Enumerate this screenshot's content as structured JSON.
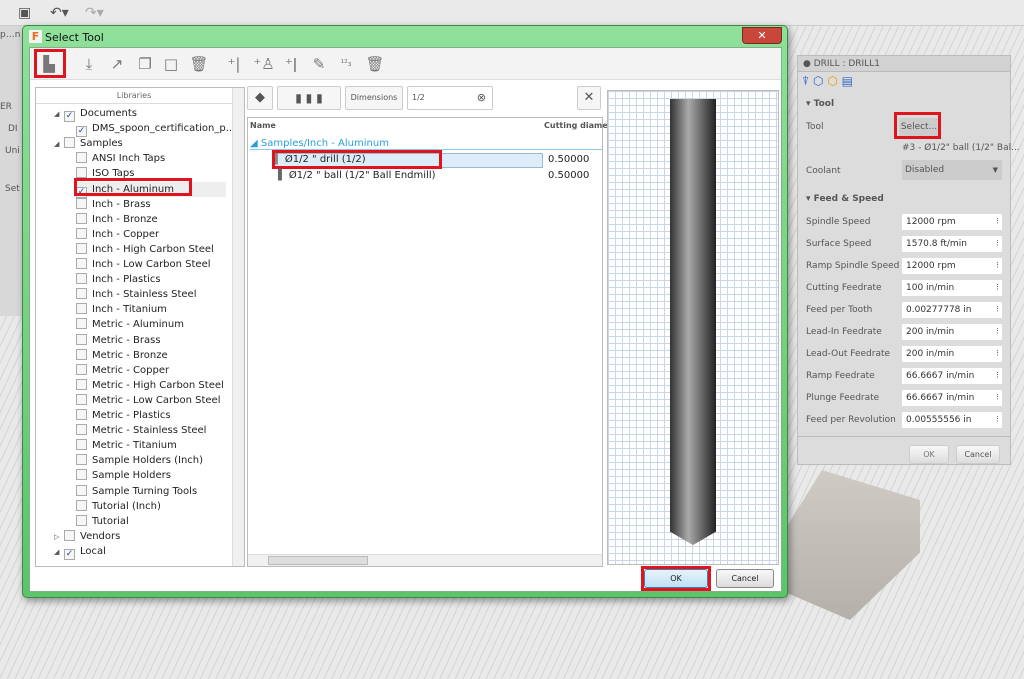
{
  "app": {
    "tab_label": "p…n",
    "left_labels": [
      "ER",
      "DI",
      "Uni",
      "Set"
    ]
  },
  "dialog": {
    "title": "Select Tool",
    "close": "✕",
    "libraries": {
      "header": "Libraries",
      "items": [
        {
          "label": "Documents",
          "level": 0,
          "checked": true,
          "expand": "open"
        },
        {
          "label": "DMS_spoon_certification_p...",
          "level": 1,
          "checked": true
        },
        {
          "label": "Samples",
          "level": 0,
          "checked": false,
          "expand": "open"
        },
        {
          "label": "ANSI Inch Taps",
          "level": 1,
          "checked": false
        },
        {
          "label": "ISO Taps",
          "level": 1,
          "checked": false
        },
        {
          "label": "Inch - Aluminum",
          "level": 1,
          "checked": true,
          "selected": true
        },
        {
          "label": "Inch - Brass",
          "level": 1
        },
        {
          "label": "Inch - Bronze",
          "level": 1
        },
        {
          "label": "Inch - Copper",
          "level": 1
        },
        {
          "label": "Inch - High Carbon Steel",
          "level": 1
        },
        {
          "label": "Inch - Low Carbon Steel",
          "level": 1
        },
        {
          "label": "Inch - Plastics",
          "level": 1
        },
        {
          "label": "Inch - Stainless Steel",
          "level": 1
        },
        {
          "label": "Inch - Titanium",
          "level": 1
        },
        {
          "label": "Metric - Aluminum",
          "level": 1
        },
        {
          "label": "Metric - Brass",
          "level": 1
        },
        {
          "label": "Metric - Bronze",
          "level": 1
        },
        {
          "label": "Metric - Copper",
          "level": 1
        },
        {
          "label": "Metric - High Carbon Steel",
          "level": 1
        },
        {
          "label": "Metric - Low Carbon Steel",
          "level": 1
        },
        {
          "label": "Metric - Plastics",
          "level": 1
        },
        {
          "label": "Metric - Stainless Steel",
          "level": 1
        },
        {
          "label": "Metric - Titanium",
          "level": 1
        },
        {
          "label": "Sample Holders (Inch)",
          "level": 1
        },
        {
          "label": "Sample Holders",
          "level": 1
        },
        {
          "label": "Sample Turning Tools",
          "level": 1
        },
        {
          "label": "Tutorial (Inch)",
          "level": 1
        },
        {
          "label": "Tutorial",
          "level": 1
        },
        {
          "label": "Vendors",
          "level": 0,
          "checked": false,
          "expand": "closed"
        },
        {
          "label": "Local",
          "level": 0,
          "checked": true,
          "expand": "open"
        }
      ]
    },
    "filter": {
      "dimensions_label": "Dimensions",
      "search_value": "1/2"
    },
    "table": {
      "col_name": "Name",
      "col_diameter": "Cutting diamete",
      "group": "Samples/Inch - Aluminum",
      "rows": [
        {
          "name": "Ø1/2 \" drill (1/2)",
          "diameter": "0.50000"
        },
        {
          "name": "Ø1/2 \" ball (1/2\" Ball Endmill)",
          "diameter": "0.50000"
        }
      ]
    },
    "ok": "OK",
    "cancel": "Cancel"
  },
  "panel": {
    "title": "DRILL : DRILL1",
    "tool_section": "Tool",
    "tool_label": "Tool",
    "select_button": "Select...",
    "tool_value": "#3 - Ø1/2\" ball (1/2\" Bal...",
    "coolant_label": "Coolant",
    "coolant_value": "Disabled",
    "feed_section": "Feed & Speed",
    "fields": [
      {
        "label": "Spindle Speed",
        "value": "12000 rpm"
      },
      {
        "label": "Surface Speed",
        "value": "1570.8 ft/min"
      },
      {
        "label": "Ramp Spindle Speed",
        "value": "12000 rpm"
      },
      {
        "label": "Cutting Feedrate",
        "value": "100 in/min"
      },
      {
        "label": "Feed per Tooth",
        "value": "0.00277778 in"
      },
      {
        "label": "Lead-In Feedrate",
        "value": "200 in/min"
      },
      {
        "label": "Lead-Out Feedrate",
        "value": "200 in/min"
      },
      {
        "label": "Ramp Feedrate",
        "value": "66.6667 in/min"
      },
      {
        "label": "Plunge Feedrate",
        "value": "66.6667 in/min"
      },
      {
        "label": "Feed per Revolution",
        "value": "0.00555556 in"
      }
    ],
    "ok": "OK",
    "cancel": "Cancel"
  },
  "colors": {
    "highlight": "#e0141e",
    "link": "#2a9fd6",
    "title_green": "#5cc46a"
  }
}
